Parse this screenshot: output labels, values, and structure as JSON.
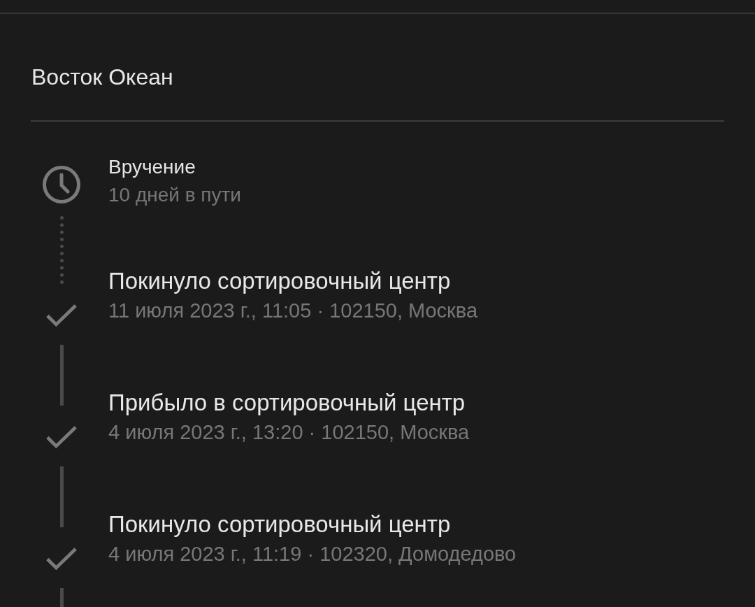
{
  "title": "Восток Океан",
  "events": [
    {
      "kind": "pending",
      "title": "Вручение",
      "subtitle": "10 дней в пути"
    },
    {
      "kind": "done",
      "title": "Покинуло сортировочный центр",
      "subtitle": "11 июля 2023 г., 11:05 · 102150, Москва"
    },
    {
      "kind": "done",
      "title": "Прибыло в сортировочный центр",
      "subtitle": "4 июля 2023 г., 13:20 · 102150, Москва"
    },
    {
      "kind": "done",
      "title": "Покинуло сортировочный центр",
      "subtitle": "4 июля 2023 г., 11:19 · 102320, Домодедово"
    }
  ]
}
